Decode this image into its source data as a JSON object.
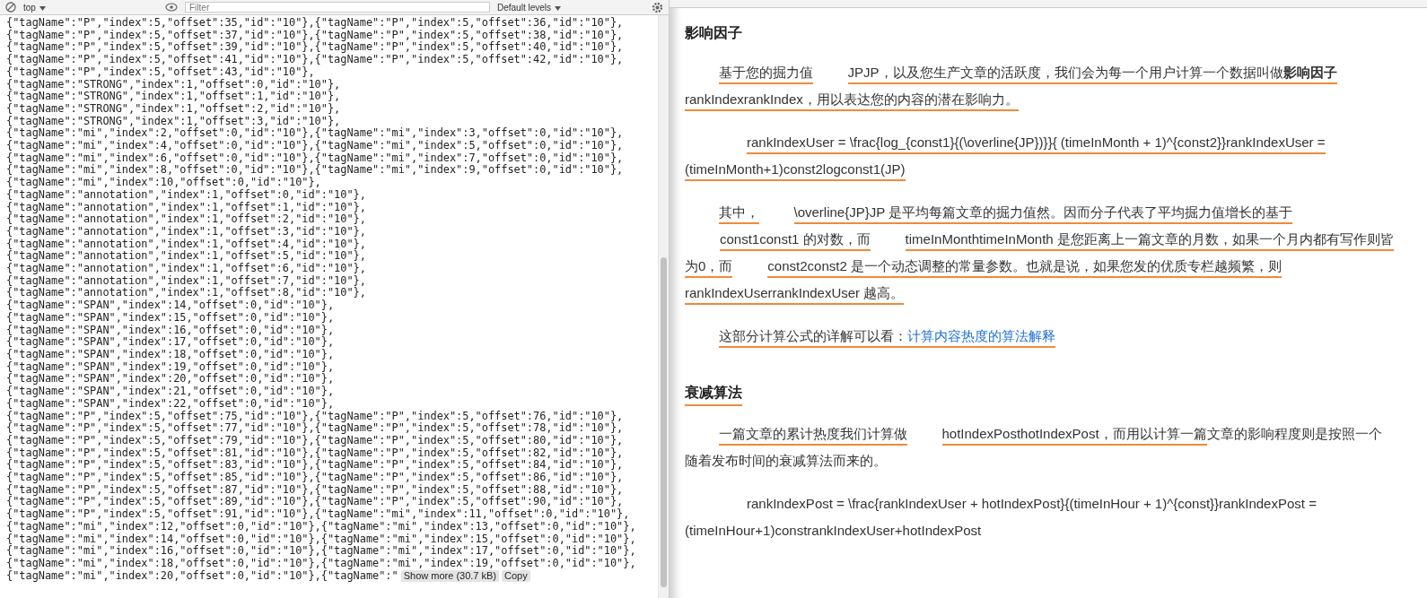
{
  "console_toolbar": {
    "context": "top",
    "filter": {
      "placeholder": "Filter"
    },
    "levels": "Default levels"
  },
  "console_output": {
    "lines": [
      "{\"tagName\":\"P\",\"index\":5,\"offset\":35,\"id\":\"10\"},{\"tagName\":\"P\",\"index\":5,\"offset\":36,\"id\":\"10\"},",
      "{\"tagName\":\"P\",\"index\":5,\"offset\":37,\"id\":\"10\"},{\"tagName\":\"P\",\"index\":5,\"offset\":38,\"id\":\"10\"},",
      "{\"tagName\":\"P\",\"index\":5,\"offset\":39,\"id\":\"10\"},{\"tagName\":\"P\",\"index\":5,\"offset\":40,\"id\":\"10\"},",
      "{\"tagName\":\"P\",\"index\":5,\"offset\":41,\"id\":\"10\"},{\"tagName\":\"P\",\"index\":5,\"offset\":42,\"id\":\"10\"},",
      "{\"tagName\":\"P\",\"index\":5,\"offset\":43,\"id\":\"10\"},",
      "{\"tagName\":\"STRONG\",\"index\":1,\"offset\":0,\"id\":\"10\"},",
      "{\"tagName\":\"STRONG\",\"index\":1,\"offset\":1,\"id\":\"10\"},",
      "{\"tagName\":\"STRONG\",\"index\":1,\"offset\":2,\"id\":\"10\"},",
      "{\"tagName\":\"STRONG\",\"index\":1,\"offset\":3,\"id\":\"10\"},",
      "{\"tagName\":\"mi\",\"index\":2,\"offset\":0,\"id\":\"10\"},{\"tagName\":\"mi\",\"index\":3,\"offset\":0,\"id\":\"10\"},",
      "{\"tagName\":\"mi\",\"index\":4,\"offset\":0,\"id\":\"10\"},{\"tagName\":\"mi\",\"index\":5,\"offset\":0,\"id\":\"10\"},",
      "{\"tagName\":\"mi\",\"index\":6,\"offset\":0,\"id\":\"10\"},{\"tagName\":\"mi\",\"index\":7,\"offset\":0,\"id\":\"10\"},",
      "{\"tagName\":\"mi\",\"index\":8,\"offset\":0,\"id\":\"10\"},{\"tagName\":\"mi\",\"index\":9,\"offset\":0,\"id\":\"10\"},",
      "{\"tagName\":\"mi\",\"index\":10,\"offset\":0,\"id\":\"10\"},",
      "{\"tagName\":\"annotation\",\"index\":1,\"offset\":0,\"id\":\"10\"},",
      "{\"tagName\":\"annotation\",\"index\":1,\"offset\":1,\"id\":\"10\"},",
      "{\"tagName\":\"annotation\",\"index\":1,\"offset\":2,\"id\":\"10\"},",
      "{\"tagName\":\"annotation\",\"index\":1,\"offset\":3,\"id\":\"10\"},",
      "{\"tagName\":\"annotation\",\"index\":1,\"offset\":4,\"id\":\"10\"},",
      "{\"tagName\":\"annotation\",\"index\":1,\"offset\":5,\"id\":\"10\"},",
      "{\"tagName\":\"annotation\",\"index\":1,\"offset\":6,\"id\":\"10\"},",
      "{\"tagName\":\"annotation\",\"index\":1,\"offset\":7,\"id\":\"10\"},",
      "{\"tagName\":\"annotation\",\"index\":1,\"offset\":8,\"id\":\"10\"},",
      "{\"tagName\":\"SPAN\",\"index\":14,\"offset\":0,\"id\":\"10\"},",
      "{\"tagName\":\"SPAN\",\"index\":15,\"offset\":0,\"id\":\"10\"},",
      "{\"tagName\":\"SPAN\",\"index\":16,\"offset\":0,\"id\":\"10\"},",
      "{\"tagName\":\"SPAN\",\"index\":17,\"offset\":0,\"id\":\"10\"},",
      "{\"tagName\":\"SPAN\",\"index\":18,\"offset\":0,\"id\":\"10\"},",
      "{\"tagName\":\"SPAN\",\"index\":19,\"offset\":0,\"id\":\"10\"},",
      "{\"tagName\":\"SPAN\",\"index\":20,\"offset\":0,\"id\":\"10\"},",
      "{\"tagName\":\"SPAN\",\"index\":21,\"offset\":0,\"id\":\"10\"},",
      "{\"tagName\":\"SPAN\",\"index\":22,\"offset\":0,\"id\":\"10\"},",
      "{\"tagName\":\"P\",\"index\":5,\"offset\":75,\"id\":\"10\"},{\"tagName\":\"P\",\"index\":5,\"offset\":76,\"id\":\"10\"},",
      "{\"tagName\":\"P\",\"index\":5,\"offset\":77,\"id\":\"10\"},{\"tagName\":\"P\",\"index\":5,\"offset\":78,\"id\":\"10\"},",
      "{\"tagName\":\"P\",\"index\":5,\"offset\":79,\"id\":\"10\"},{\"tagName\":\"P\",\"index\":5,\"offset\":80,\"id\":\"10\"},",
      "{\"tagName\":\"P\",\"index\":5,\"offset\":81,\"id\":\"10\"},{\"tagName\":\"P\",\"index\":5,\"offset\":82,\"id\":\"10\"},",
      "{\"tagName\":\"P\",\"index\":5,\"offset\":83,\"id\":\"10\"},{\"tagName\":\"P\",\"index\":5,\"offset\":84,\"id\":\"10\"},",
      "{\"tagName\":\"P\",\"index\":5,\"offset\":85,\"id\":\"10\"},{\"tagName\":\"P\",\"index\":5,\"offset\":86,\"id\":\"10\"},",
      "{\"tagName\":\"P\",\"index\":5,\"offset\":87,\"id\":\"10\"},{\"tagName\":\"P\",\"index\":5,\"offset\":88,\"id\":\"10\"},",
      "{\"tagName\":\"P\",\"index\":5,\"offset\":89,\"id\":\"10\"},{\"tagName\":\"P\",\"index\":5,\"offset\":90,\"id\":\"10\"},",
      "{\"tagName\":\"P\",\"index\":5,\"offset\":91,\"id\":\"10\"},{\"tagName\":\"mi\",\"index\":11,\"offset\":0,\"id\":\"10\"},",
      "{\"tagName\":\"mi\",\"index\":12,\"offset\":0,\"id\":\"10\"},{\"tagName\":\"mi\",\"index\":13,\"offset\":0,\"id\":\"10\"},",
      "{\"tagName\":\"mi\",\"index\":14,\"offset\":0,\"id\":\"10\"},{\"tagName\":\"mi\",\"index\":15,\"offset\":0,\"id\":\"10\"},",
      "{\"tagName\":\"mi\",\"index\":16,\"offset\":0,\"id\":\"10\"},{\"tagName\":\"mi\",\"index\":17,\"offset\":0,\"id\":\"10\"},",
      "{\"tagName\":\"mi\",\"index\":18,\"offset\":0,\"id\":\"10\"},{\"tagName\":\"mi\",\"index\":19,\"offset\":0,\"id\":\"10\"},",
      "{\"tagName\":\"mi\",\"index\":20,\"offset\":0,\"id\":\"10\"},{\"tagName\":\""
    ],
    "buttons": [
      "Show more (30.7 kB)",
      "Copy"
    ]
  },
  "article": {
    "sections": [
      {
        "heading": "影响因子",
        "underlined": false,
        "paragraphs": [
          {
            "kind": "text",
            "segments": [
              {
                "kind": "plain",
                "text": "基于您的掘力值",
                "underlined": true
              },
              {
                "kind": "math",
                "text": "JPJP",
                "underlined": true
              },
              {
                "kind": "plain",
                "text": "，以及您生产文章的活跃度，我们会为每一个用户计算一个数据叫做",
                "underlined": true
              },
              {
                "kind": "bold",
                "text": "影响因子",
                "underlined": true
              },
              {
                "kind": "plain",
                "text": "rankIndexrankIndex",
                "underlined": true
              },
              {
                "kind": "plain",
                "text": "，用以表达您的内容的潜在影响力。",
                "underlined": true
              }
            ]
          },
          {
            "kind": "formula",
            "segments": [
              {
                "kind": "plain",
                "text": "rankIndexUser = \\frac{log_{const1}{(\\overline{JP})}}{ (timeInMonth + 1)^{const2}}rankIndexUser = (timeInMonth+1)const2logconst1(JP)",
                "underlined": true
              }
            ]
          },
          {
            "kind": "text",
            "segments": [
              {
                "kind": "plain",
                "text": "其中，",
                "underlined": true
              },
              {
                "kind": "math",
                "text": "\\overline{JP}JP",
                "underlined": true
              },
              {
                "kind": "plain",
                "text": " 是平均每篇文章的掘力值然。因而分子代表了平均掘力值增长的基于",
                "underlined": true
              },
              {
                "kind": "math",
                "text": "const1const1",
                "underlined": true
              },
              {
                "kind": "plain",
                "text": " 的对数，而",
                "underlined": true
              },
              {
                "kind": "math",
                "text": "timeInMonthtimeInMonth",
                "underlined": true
              },
              {
                "kind": "plain",
                "text": " 是您距离上一篇文章的月数，如果一个月内都有写作则皆为0，而",
                "underlined": true
              },
              {
                "kind": "math",
                "text": "const2const2",
                "underlined": true
              },
              {
                "kind": "plain",
                "text": " 是一个动态调整的常量参数。也就是说，如果您发的优质专栏越频繁，则",
                "underlined": true
              },
              {
                "kind": "break",
                "text": "rankIndexUserrankIndexUser",
                "underlined": true
              },
              {
                "kind": "plain",
                "text": " 越高。",
                "underlined": true
              }
            ]
          },
          {
            "kind": "text",
            "segments": [
              {
                "kind": "plain",
                "text": "这部分计算公式的详解可以看：",
                "underlined": true
              },
              {
                "kind": "link",
                "text": "计算内容热度的算法解释",
                "underlined": true
              }
            ]
          }
        ]
      },
      {
        "heading": "衰减算法",
        "underlined": true,
        "paragraphs": [
          {
            "kind": "text",
            "segments": [
              {
                "kind": "plain",
                "text": "一篇文章的累计热度我们计算做",
                "underlined": true
              },
              {
                "kind": "math",
                "text": "hotIndexPosthotIndexPost",
                "underlined": true
              },
              {
                "kind": "plain",
                "text": "，而用以计算一篇",
                "underlined": true
              },
              {
                "kind": "plain",
                "text": "文章的影响程度则是按照一个随着发布时间的衰减算法而来的。",
                "underlined": false
              }
            ]
          },
          {
            "kind": "formula",
            "segments": [
              {
                "kind": "plain",
                "text": "rankIndexPost = \\frac{rankIndexUser + hotIndexPost}{(timeInHour + 1)^{const}}rankIndexPost = (timeInHour+1)constrankIndexUser+hotIndexPost",
                "underlined": false
              }
            ]
          }
        ]
      }
    ]
  }
}
